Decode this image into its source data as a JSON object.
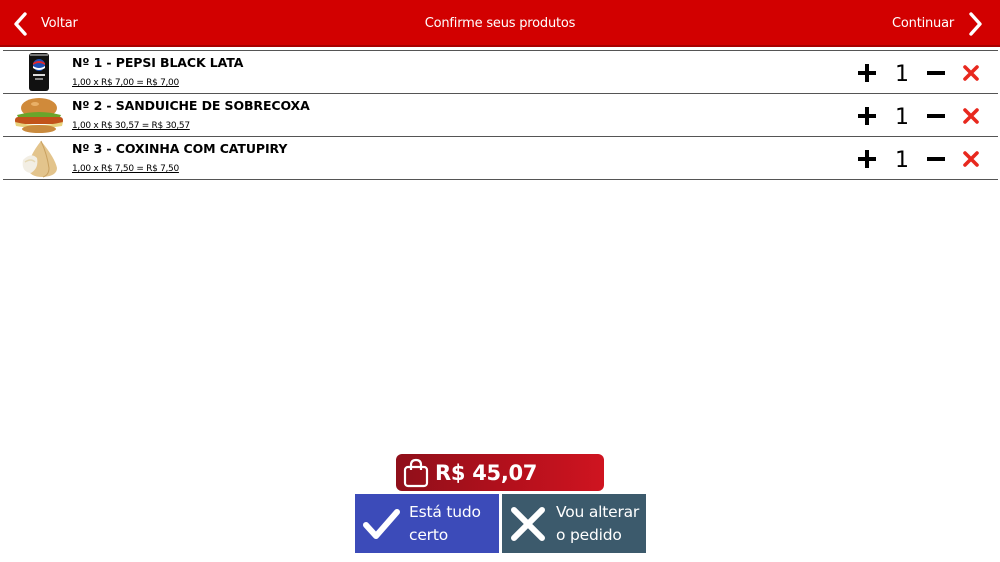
{
  "header": {
    "back_label": "Voltar",
    "title": "Confirme seus produtos",
    "next_label": "Continuar",
    "bg_color": "#d20000"
  },
  "items": [
    {
      "name": "Nº 1 - PEPSI BLACK LATA",
      "price_line": "1,00 x R$ 7,00 = R$ 7,00",
      "quantity": "1",
      "image": "pepsi-can-image"
    },
    {
      "name": "Nº 2 - SANDUICHE DE SOBRECOXA",
      "price_line": "1,00 x R$ 30,57 = R$ 30,57",
      "quantity": "1",
      "image": "chicken-sandwich-image"
    },
    {
      "name": "Nº 3 - COXINHA COM CATUPIRY",
      "price_line": "1,00 x R$ 7,50 = R$ 7,50",
      "quantity": "1",
      "image": "coxinha-image"
    }
  ],
  "total": {
    "value": "R$ 45,07",
    "icon": "shopping-bag-icon"
  },
  "actions": {
    "confirm_line1": "Está tudo",
    "confirm_line2": "certo",
    "change_line1": "Vou alterar",
    "change_line2": "o pedido",
    "confirm_color": "#3c4bb9",
    "change_color": "#3c5a6c"
  },
  "icons": {
    "increase": "plus-icon",
    "decrease": "minus-icon",
    "remove": "close-icon",
    "remove_color": "#e8281e"
  }
}
